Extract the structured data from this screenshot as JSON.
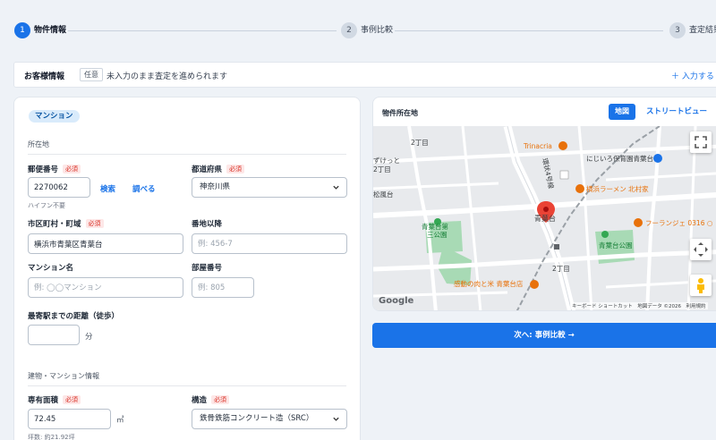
{
  "stepper": {
    "steps": [
      {
        "number": "1",
        "label": "物件情報",
        "state": "active"
      },
      {
        "number": "2",
        "label": "事例比較",
        "state": "inactive"
      },
      {
        "number": "3",
        "label": "査定結果",
        "state": "inactive"
      }
    ]
  },
  "customer_bar": {
    "title": "お客様情報",
    "badge": "任意",
    "description": "未入力のまま査定を進められます",
    "add_label": "＋ 入力する"
  },
  "form": {
    "property_type": "マンション",
    "location_section": "所在地",
    "postal_code": {
      "label": "郵便番号",
      "required": "必須",
      "value": "2270062",
      "search_label": "検索",
      "lookup_label": "調べる",
      "hint": "ハイフン不要"
    },
    "prefecture": {
      "label": "都道府県",
      "required": "必須",
      "value": "神奈川県"
    },
    "city": {
      "label": "市区町村・町域",
      "required": "必須",
      "value": "横浜市青葉区青葉台"
    },
    "address": {
      "label": "番地以降",
      "placeholder": "例: 456-7"
    },
    "mansion_name": {
      "label": "マンション名",
      "placeholder": "例: ◯◯マンション"
    },
    "room_number": {
      "label": "部屋番号",
      "placeholder": "例: 805"
    },
    "walk_distance": {
      "label": "最寄駅までの距離（徒歩）",
      "value": "",
      "unit": "分"
    },
    "building_section": "建物・マンション情報",
    "area": {
      "label": "専有面積",
      "required": "必須",
      "value": "72.45",
      "unit": "㎡",
      "hint": "坪数: 約21.92坪"
    },
    "structure": {
      "label": "構造",
      "required": "必須",
      "value": "鉄骨鉄筋コンクリート造（SRC）"
    }
  },
  "map": {
    "title": "物件所在地",
    "tab_map": "地図",
    "tab_street": "ストリートビュー",
    "labels": {
      "chome2": "2丁目",
      "chome2b": "2丁目",
      "trinacria": "Trinacria",
      "nijiiro": "にじいろ保育園青葉台",
      "sugitte": "ずけっと",
      "chome2c": "2丁目",
      "matsukaze": "松風台",
      "aoba_park1": "青葉台第",
      "aoba_park1b": "三公園",
      "station": "青葉台",
      "yokohama_ramen": "横浜ラーメン 北村家",
      "fleurange": "フーランジェ 0316 ○",
      "aoba_park2": "青葉台公園",
      "kandou": "感動の肉と米 青葉台店",
      "route": "環状4号線"
    },
    "google": "Google",
    "attribution": "キーボード ショートカット　地図データ ©2026　利用規約"
  },
  "next_button": "次へ: 事例比較 →"
}
